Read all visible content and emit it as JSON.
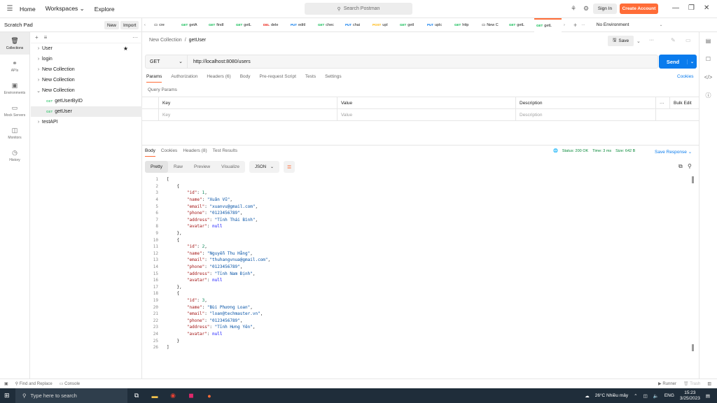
{
  "topbar": {
    "home": "Home",
    "workspaces": "Workspaces",
    "explore": "Explore",
    "search_placeholder": "Search Postman",
    "sign_in": "Sign In",
    "create_account": "Create Account"
  },
  "rail": [
    {
      "label": "Collections",
      "icon": "collections-icon"
    },
    {
      "label": "APIs",
      "icon": "apis-icon"
    },
    {
      "label": "Environments",
      "icon": "environments-icon"
    },
    {
      "label": "Mock Servers",
      "icon": "mock-servers-icon"
    },
    {
      "label": "Monitors",
      "icon": "monitors-icon"
    },
    {
      "label": "History",
      "icon": "history-icon"
    }
  ],
  "sidebar": {
    "title": "Scratch Pad",
    "new_label": "New",
    "import_label": "Import",
    "items": [
      {
        "label": "User"
      },
      {
        "label": "login"
      },
      {
        "label": "New Collection"
      },
      {
        "label": "New Collection"
      },
      {
        "label": "New Collection"
      },
      {
        "label": "getUserByID",
        "method": "GET"
      },
      {
        "label": "getUser",
        "method": "GET"
      },
      {
        "label": "testAPI"
      }
    ]
  },
  "tabs": [
    {
      "method": "",
      "label": "cre"
    },
    {
      "method": "GET",
      "label": "getA"
    },
    {
      "method": "GET",
      "label": "findI"
    },
    {
      "method": "GET",
      "label": "getL"
    },
    {
      "method": "DEL",
      "label": "dele"
    },
    {
      "method": "PUT",
      "label": "editl"
    },
    {
      "method": "GET",
      "label": "chec"
    },
    {
      "method": "PUT",
      "label": "chai"
    },
    {
      "method": "POST",
      "label": "upl"
    },
    {
      "method": "GET",
      "label": "getl"
    },
    {
      "method": "PUT",
      "label": "uplc"
    },
    {
      "method": "GET",
      "label": "http"
    },
    {
      "method": "",
      "label": "New C"
    },
    {
      "method": "GET",
      "label": "getL"
    },
    {
      "method": "GET",
      "label": "getL"
    }
  ],
  "environment": "No Environment",
  "breadcrumb": {
    "collection": "New Collection",
    "request": "getUser"
  },
  "save_label": "Save",
  "request": {
    "method": "GET",
    "url": "http://localhost:8080/users",
    "send": "Send"
  },
  "req_tabs": [
    "Params",
    "Authorization",
    "Headers (6)",
    "Body",
    "Pre-request Script",
    "Tests",
    "Settings"
  ],
  "cookies": "Cookies",
  "query_params": "Query Params",
  "params_table": {
    "headers": [
      "Key",
      "Value",
      "Description",
      "Bulk Edit"
    ],
    "placeholders": [
      "Key",
      "Value",
      "Description"
    ]
  },
  "resp_tabs": [
    "Body",
    "Cookies",
    "Headers (8)",
    "Test Results"
  ],
  "status": {
    "status": "Status: 200 OK",
    "time": "Time: 3 ms",
    "size": "Size: 642 B"
  },
  "save_response": "Save Response",
  "view_modes": [
    "Pretty",
    "Raw",
    "Preview",
    "Visualize"
  ],
  "format": "JSON",
  "response_lines": [
    "[",
    "    {",
    "        \"id\": 1,",
    "        \"name\": \"Xuân Vũ\",",
    "        \"email\": \"xuanvu@gmail.com\",",
    "        \"phone\": \"0123456789\",",
    "        \"address\": \"Tỉnh Thái Bình\",",
    "        \"avatar\": null",
    "    },",
    "    {",
    "        \"id\": 2,",
    "        \"name\": \"Nguyễn Thu Hằng\",",
    "        \"email\": \"thuhangvnua@gmail.com\",",
    "        \"phone\": \"0123456789\",",
    "        \"address\": \"Tỉnh Nam Định\",",
    "        \"avatar\": null",
    "    },",
    "    {",
    "        \"id\": 3,",
    "        \"name\": \"Bùi Phương Loan\",",
    "        \"email\": \"loan@techmaster.vn\",",
    "        \"phone\": \"0123456789\",",
    "        \"address\": \"Tỉnh Hưng Yên\",",
    "        \"avatar\": null",
    "    }",
    "]"
  ],
  "footer": {
    "find_replace": "Find and Replace",
    "console": "Console",
    "runner": "Runner",
    "trash": "Trash"
  },
  "taskbar": {
    "search": "Type here to search",
    "weather": "26°C  Nhiều mây",
    "lang": "ENG",
    "time": "15:23",
    "date": "3/25/2023"
  }
}
